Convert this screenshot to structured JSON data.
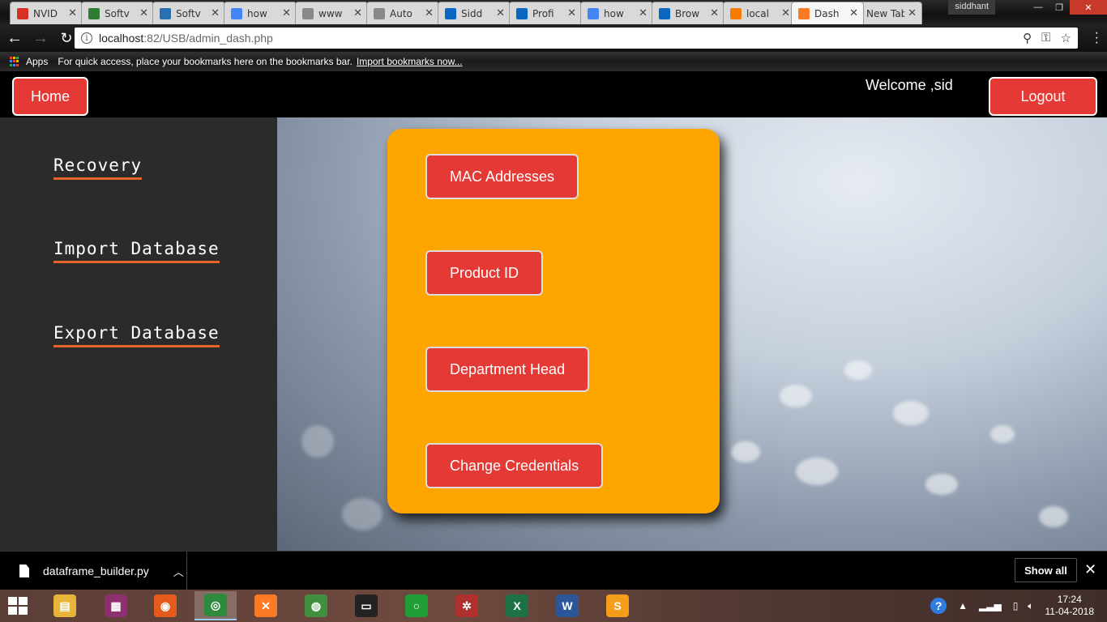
{
  "browser": {
    "tabs": [
      {
        "title": "NVID",
        "icon": "gmail-icon",
        "color": "#d93025"
      },
      {
        "title": "Softv",
        "icon": "green-app-icon",
        "color": "#2e7d32"
      },
      {
        "title": "Softv",
        "icon": "wordpress-icon",
        "color": "#2a6fb0"
      },
      {
        "title": "how",
        "icon": "google-icon",
        "color": "#4285f4"
      },
      {
        "title": "www",
        "icon": "document-icon",
        "color": "#888888"
      },
      {
        "title": "Auto",
        "icon": "document-icon",
        "color": "#888888"
      },
      {
        "title": "Sidd",
        "icon": "linkedin-icon",
        "color": "#0a66c2"
      },
      {
        "title": "Profi",
        "icon": "linkedin-icon",
        "color": "#0a66c2"
      },
      {
        "title": "how",
        "icon": "google-icon",
        "color": "#4285f4"
      },
      {
        "title": "Brow",
        "icon": "linkedin-icon",
        "color": "#0a66c2"
      },
      {
        "title": "local",
        "icon": "xampp-server-icon",
        "color": "#f57c00"
      },
      {
        "title": "Dash",
        "icon": "xampp-icon",
        "color": "#fb7a24",
        "active": true
      },
      {
        "title": "New Tab",
        "icon": "",
        "color": ""
      }
    ],
    "user": "siddhant",
    "url_host": "localhost",
    "url_path": ":82/USB/admin_dash.php",
    "bookmarks": {
      "apps_label": "Apps",
      "hint": "For quick access, place your bookmarks here on the bookmarks bar.",
      "import_link": "Import bookmarks now..."
    }
  },
  "page": {
    "home_label": "Home",
    "welcome": "Welcome ,sid",
    "logout_label": "Logout",
    "sidebar": [
      "Recovery",
      "Import Database",
      "Export Database"
    ],
    "actions": [
      "MAC Addresses",
      "Product ID",
      "Department Head",
      "Change Credentials"
    ],
    "colors": {
      "accent": "#e53935",
      "card": "#ffa500",
      "underline": "#e8632a",
      "sidebar": "#2b2b2b"
    }
  },
  "downloads": {
    "file": "dataframe_builder.py",
    "show_all": "Show all"
  },
  "taskbar": {
    "apps": [
      {
        "name": "file-explorer-icon",
        "color": "#e8b43a",
        "glyph": "▤"
      },
      {
        "name": "winrar-icon",
        "color": "#8e2f6f",
        "glyph": "▦"
      },
      {
        "name": "firefox-icon",
        "color": "#e55b1e",
        "glyph": "◉"
      },
      {
        "name": "chrome-icon",
        "color": "#2e8b3d",
        "glyph": "◎",
        "active": true
      },
      {
        "name": "xampp-icon",
        "color": "#fb7a24",
        "glyph": "✕"
      },
      {
        "name": "network-globe-icon",
        "color": "#3f8f3f",
        "glyph": "◍"
      },
      {
        "name": "terminal-icon",
        "color": "#222222",
        "glyph": "▭"
      },
      {
        "name": "spinner-app-icon",
        "color": "#1f9d36",
        "glyph": "○"
      },
      {
        "name": "spider-web-icon",
        "color": "#b03030",
        "glyph": "✲"
      },
      {
        "name": "excel-icon",
        "color": "#1e7145",
        "glyph": "X"
      },
      {
        "name": "word-icon",
        "color": "#2b579a",
        "glyph": "W"
      },
      {
        "name": "sublime-text-icon",
        "color": "#f49d1a",
        "glyph": "S"
      }
    ],
    "time": "17:24",
    "date": "11-04-2018"
  }
}
